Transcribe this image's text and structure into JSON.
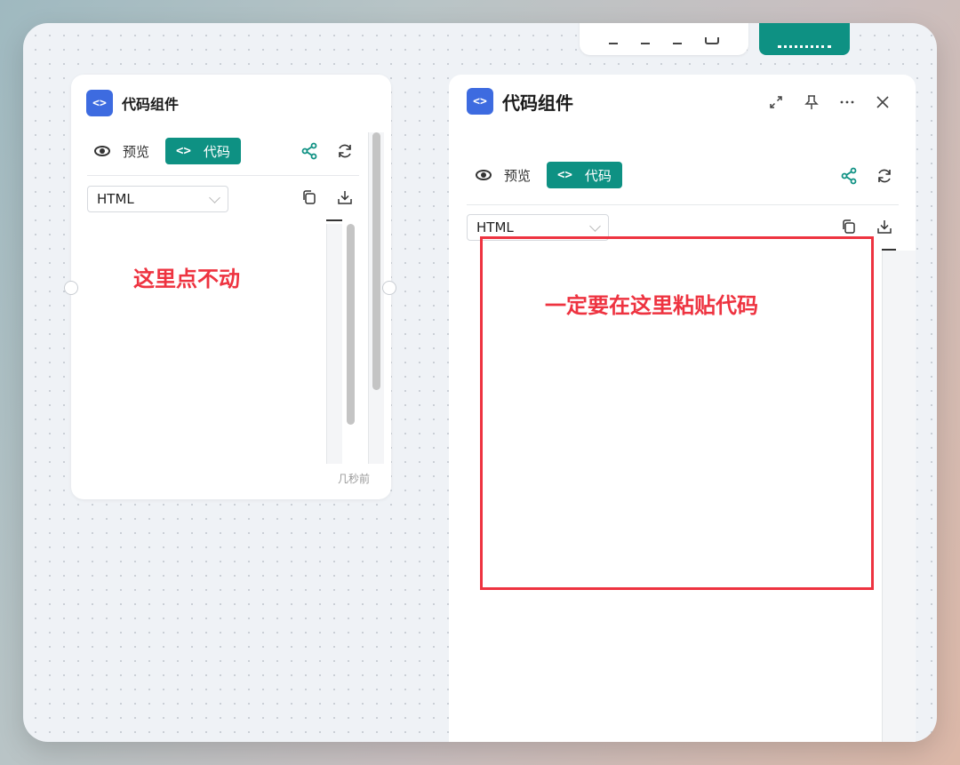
{
  "top_toolbar": {
    "button_label": ""
  },
  "left_panel": {
    "title": "代码组件",
    "badge": "<>",
    "tab_preview": "预览",
    "tab_code": "代码",
    "tab_code_icon": "<>",
    "language": "HTML",
    "annotation": "这里点不动",
    "timestamp": "几秒前"
  },
  "right_panel": {
    "title": "代码组件",
    "badge": "<>",
    "tab_preview": "预览",
    "tab_code": "代码",
    "tab_code_icon": "<>",
    "language": "HTML",
    "annotation": "一定要在这里粘贴代码"
  },
  "colors": {
    "accent": "#0e9183",
    "badge": "#3d6be0",
    "annotation": "#ee3340"
  },
  "icons": [
    "eye-icon",
    "share-icon",
    "refresh-icon",
    "copy-icon",
    "download-icon",
    "expand-icon",
    "pin-icon",
    "more-icon",
    "close-icon",
    "chevron-down-icon"
  ]
}
